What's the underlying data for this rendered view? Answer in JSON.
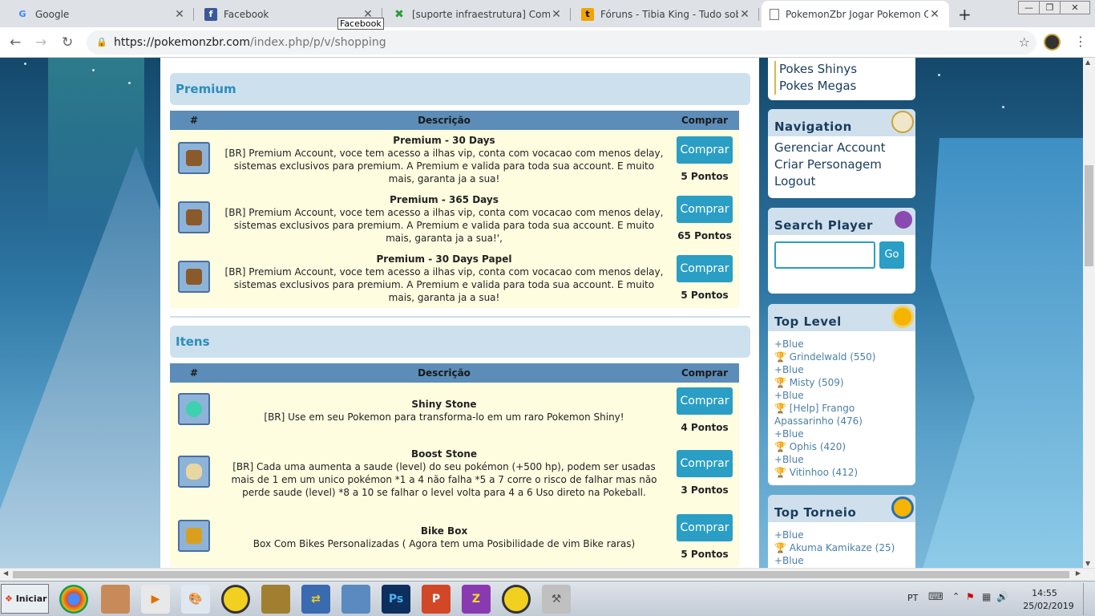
{
  "browser": {
    "tabs": [
      {
        "title": "Google",
        "icon": "google-icon",
        "active": false
      },
      {
        "title": "Facebook",
        "icon": "facebook-icon",
        "active": false
      },
      {
        "title": "[suporte infraestrutura] Como comp",
        "icon": "xenforo-icon",
        "active": false
      },
      {
        "title": "Fóruns - Tibia King - Tudo sobre Tibi",
        "icon": "tibiaking-icon",
        "active": false
      },
      {
        "title": "PokemonZbr Jogar Pokemon Online",
        "icon": "page-icon",
        "active": true
      }
    ],
    "tooltip": "Facebook",
    "url_host": "https://pokemonzbr.com",
    "url_path": "/index.php/p/v/shopping"
  },
  "shop": {
    "premium": {
      "title": "Premium",
      "col_num": "#",
      "col_desc": "Descrição",
      "col_buy": "Comprar",
      "items": [
        {
          "name": "Premium - 30 Days",
          "desc": "[BR] Premium Account, voce tem acesso a ilhas vip, conta com vocacao com menos delay, sistemas exclusivos para premium. A Premium e valida para toda sua account. E muito mais, garanta ja a sua!",
          "button": "Comprar",
          "price": "5 Pontos"
        },
        {
          "name": "Premium - 365 Days",
          "desc": "[BR] Premium Account, voce tem acesso a ilhas vip, conta com vocacao com menos delay, sistemas exclusivos para premium. A Premium e valida para toda sua account. E muito mais, garanta ja a sua!',",
          "button": "Comprar",
          "price": "65 Pontos"
        },
        {
          "name": "Premium - 30 Days Papel",
          "desc": "[BR] Premium Account, voce tem acesso a ilhas vip, conta com vocacao com menos delay, sistemas exclusivos para premium. A Premium e valida para toda sua account. E muito mais, garanta ja a sua!",
          "button": "Comprar",
          "price": "5 Pontos"
        }
      ]
    },
    "itens": {
      "title": "Itens",
      "col_num": "#",
      "col_desc": "Descrição",
      "col_buy": "Comprar",
      "items": [
        {
          "name": "Shiny Stone",
          "desc": "[BR] Use em seu Pokemon para transforma-lo em um raro Pokemon Shiny!",
          "button": "Comprar",
          "price": "4 Pontos"
        },
        {
          "name": "Boost Stone",
          "desc": "[BR] Cada uma aumenta a saude (level) do seu pokémon (+500 hp), podem ser usadas mais de 1 em um unico pokémon *1 a 4 não falha *5 a 7 corre o risco de falhar mas não perde saude (level) *8 a 10 se falhar o level volta para 4 a 6 Uso direto na Pokeball.",
          "button": "Comprar",
          "price": "3 Pontos"
        },
        {
          "name": "Bike Box",
          "desc": "Box Com Bikes Personalizadas ( Agora tem uma Posibilidade de vim Bike raras)",
          "button": "Comprar",
          "price": "5 Pontos"
        }
      ]
    }
  },
  "sidebar": {
    "pokes_links": [
      "Pokes Shinys",
      "Pokes Megas"
    ],
    "navigation": {
      "title": "Navigation",
      "links": [
        "Gerenciar Account",
        "Criar Personagem",
        "Logout"
      ]
    },
    "search": {
      "title": "Search Player",
      "button": "Go"
    },
    "top_level": {
      "title": "Top Level",
      "entries": [
        {
          "more": "+Blue",
          "name": "Grindelwald (550)"
        },
        {
          "more": "+Blue",
          "name": "Misty (509)"
        },
        {
          "more": "+Blue",
          "name": "[Help] Frango Apassarinho (476)"
        },
        {
          "more": "+Blue",
          "name": "Ophis (420)"
        },
        {
          "more": "+Blue",
          "name": "Vitinhoo (412)"
        }
      ]
    },
    "top_torneio": {
      "title": "Top Torneio",
      "entries": [
        {
          "more": "+Blue",
          "name": "Akuma Kamikaze (25)"
        },
        {
          "more": "+Blue",
          "name": ""
        }
      ]
    }
  },
  "taskbar": {
    "start": "Iniciar",
    "lang": "PT",
    "time": "14:55",
    "date": "25/02/2019"
  },
  "colors": {
    "accent": "#2a9ec4",
    "section_bg": "#cde0ed",
    "table_header": "#5b8db8",
    "row_bg": "#fefde0"
  }
}
